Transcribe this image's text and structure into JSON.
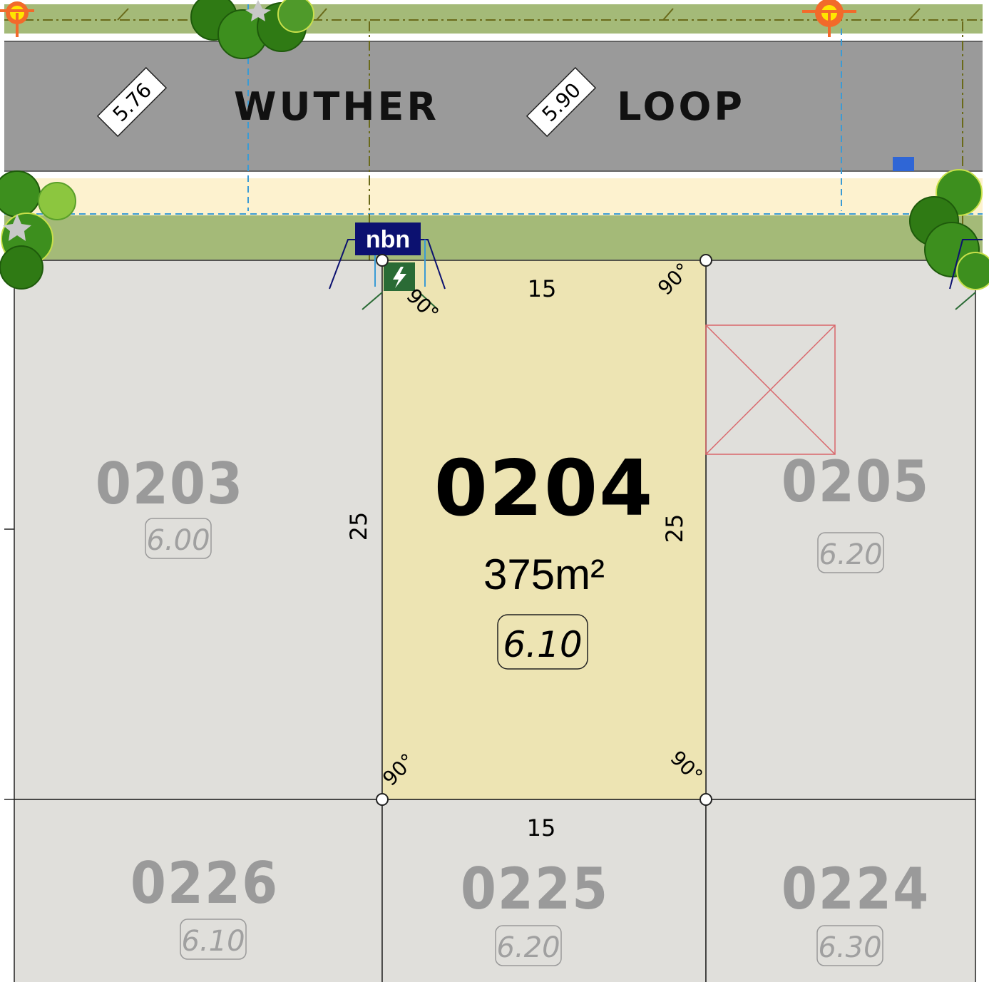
{
  "road": {
    "name_part1": "WUTHER",
    "name_part2": "LOOP"
  },
  "road_levels": [
    "5.76",
    "5.90"
  ],
  "selected_lot": {
    "number": "0204",
    "area": "375m²",
    "level": "6.10",
    "frontage": "15",
    "rear": "15",
    "side_left": "25",
    "side_right": "25",
    "angles": [
      "90°",
      "90°",
      "90°",
      "90°"
    ]
  },
  "lots": [
    {
      "number": "0203",
      "level": "6.00"
    },
    {
      "number": "0205",
      "level": "6.20"
    },
    {
      "number": "0226",
      "level": "6.10"
    },
    {
      "number": "0225",
      "level": "6.20"
    },
    {
      "number": "0224",
      "level": "6.30"
    }
  ],
  "nbn_label": "nbn",
  "colors": {
    "road": "#9a9a9a",
    "verge": "#a4ba78",
    "footpath": "#fdf2cf",
    "lot": "#e0dfdb",
    "selected_lot": "#ede4b3",
    "nbn": "#0c1170",
    "power": "#2a6b35",
    "streetlight": "#f26a2a",
    "water_service": "#3a9bd5",
    "hydrant": "#2f66d6",
    "tree": "#3d8f1e",
    "crossover_marker": "#d9666b"
  },
  "icons": [
    "streetlight-icon",
    "tree-icon",
    "nbn-pit-icon",
    "power-dome-icon",
    "hydrant-icon"
  ]
}
